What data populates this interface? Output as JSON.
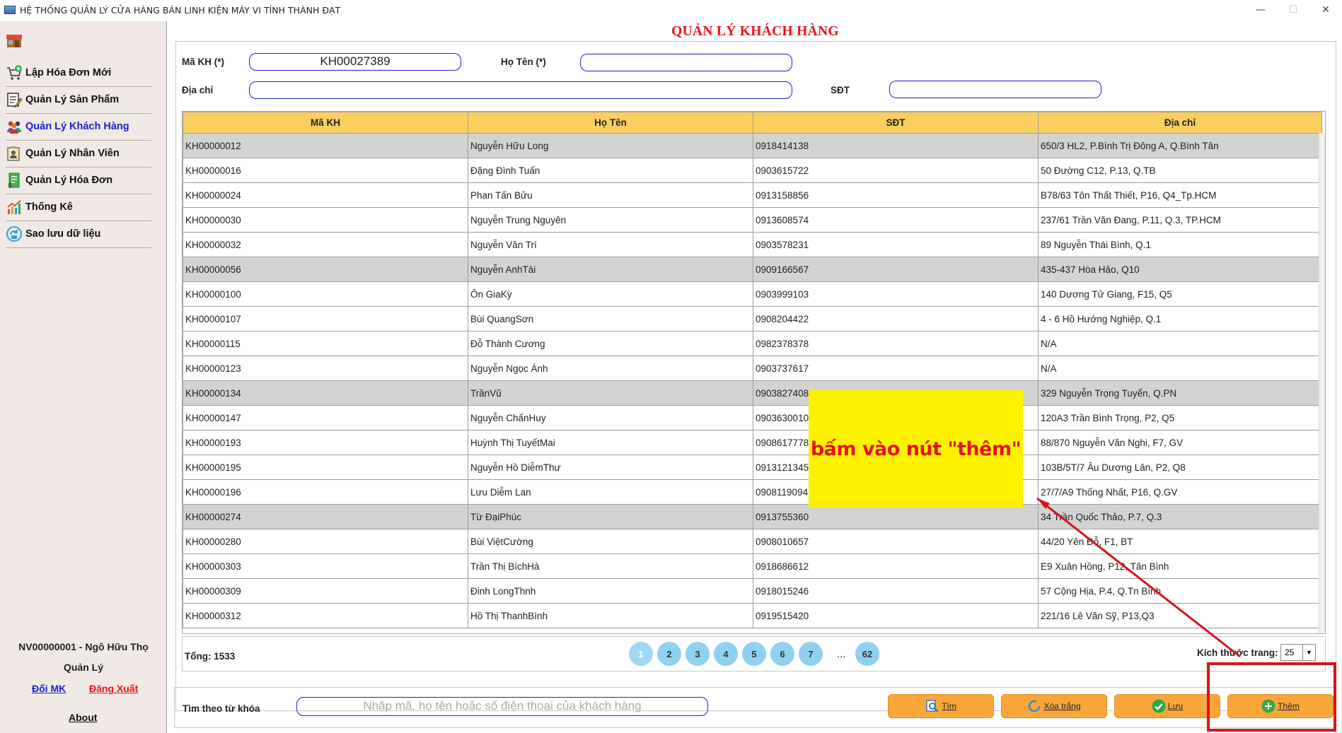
{
  "window": {
    "title": "HỆ THỐNG QUẢN LÝ CỬA HÀNG BÁN LINH KIỆN MÁY VI TÍNH THÀNH ĐẠT",
    "minimize": "—",
    "maximize": "☐",
    "close": "✕"
  },
  "sidebar": {
    "items": [
      {
        "label": "Lập Hóa Đơn Mới",
        "icon": "cart-add-icon"
      },
      {
        "label": "Quản Lý Sản Phẩm",
        "icon": "edit-list-icon"
      },
      {
        "label": "Quản Lý Khách Hàng",
        "icon": "customers-icon"
      },
      {
        "label": "Quản Lý Nhân Viên",
        "icon": "employee-icon"
      },
      {
        "label": "Quản Lý Hóa Đơn",
        "icon": "invoice-icon"
      },
      {
        "label": "Thống Kê",
        "icon": "chart-icon"
      },
      {
        "label": "Sao lưu dữ liệu",
        "icon": "backup-icon"
      }
    ],
    "active_index": 2,
    "user_line": "NV00000001 - Ngô Hữu  Thọ",
    "role": "Quản Lý",
    "change_password": "Đổi MK",
    "logout": "Đăng Xuất",
    "about": "About"
  },
  "page": {
    "title": "QUẢN LÝ KHÁCH HÀNG"
  },
  "form": {
    "id_label": "Mã KH (*)",
    "id_value": "KH00027389",
    "name_label": "Họ Tên (*)",
    "name_value": "",
    "address_label": "Địa chỉ",
    "address_value": "",
    "phone_label": "SĐT",
    "phone_value": ""
  },
  "table": {
    "columns": [
      "Mã KH",
      "Họ Tên",
      "SĐT",
      "Địa chỉ"
    ],
    "rows": [
      {
        "id": "KH00000012",
        "name": "Nguyễn Hữu Long",
        "phone": "0918414138",
        "address": "650/3 HL2, P.Bình Trị Đông A, Q.Bình Tân",
        "shaded": true
      },
      {
        "id": "KH00000016",
        "name": "Đặng Đình Tuấn",
        "phone": "0903615722",
        "address": "50 Đường C12, P.13, Q.TB",
        "shaded": false
      },
      {
        "id": "KH00000024",
        "name": "Phan Tấn Bửu",
        "phone": "0913158856",
        "address": "B78/63 Tôn Thất Thiết, P16, Q4_Tp.HCM",
        "shaded": false
      },
      {
        "id": "KH00000030",
        "name": "Nguyễn Trung Nguyên",
        "phone": "0913608574",
        "address": "237/61 Trần Văn Đang, P.11, Q.3, TP.HCM",
        "shaded": false
      },
      {
        "id": "KH00000032",
        "name": "Nguyễn Văn Trí",
        "phone": "0903578231",
        "address": "89 Nguyễn Thái Bình, Q.1",
        "shaded": false
      },
      {
        "id": "KH00000056",
        "name": "Nguyễn AnhTài",
        "phone": "0909166567",
        "address": "435-437 Hòa Hảo, Q10",
        "shaded": true
      },
      {
        "id": "KH00000100",
        "name": "Ôn GiaKỳ",
        "phone": "0903999103",
        "address": "140 Dương Tử Giang, F15, Q5",
        "shaded": false
      },
      {
        "id": "KH00000107",
        "name": "Bùi QuangSơn",
        "phone": "0908204422",
        "address": "4 - 6 Hồ Hướng Nghiệp, Q.1",
        "shaded": false
      },
      {
        "id": "KH00000115",
        "name": "Đỗ Thành Cương",
        "phone": "0982378378",
        "address": "N/A",
        "shaded": false
      },
      {
        "id": "KH00000123",
        "name": "Nguyễn Ngọc Ánh",
        "phone": "0903737617",
        "address": "N/A",
        "shaded": false
      },
      {
        "id": "KH00000134",
        "name": "TrầnVũ",
        "phone": "0903827408",
        "address": "329 Nguyễn Trọng Tuyển, Q.PN",
        "shaded": true
      },
      {
        "id": "KH00000147",
        "name": "Nguyễn ChấnHuy",
        "phone": "0903630010",
        "address": "120A3 Trần Bình Trọng, P2, Q5",
        "shaded": false
      },
      {
        "id": "KH00000193",
        "name": "Huỳnh Thị TuyếtMai",
        "phone": "0908617778",
        "address": "88/870 Nguyễn Văn Nghi, F7, GV",
        "shaded": false
      },
      {
        "id": "KH00000195",
        "name": "Nguyễn Hồ DiễmThư",
        "phone": "0913121345",
        "address": "103B/5T/7 Âu Dương Lân, P2, Q8",
        "shaded": false
      },
      {
        "id": "KH00000196",
        "name": "Lưu Diễm Lan",
        "phone": "0908119094",
        "address": "27/7/A9 Thống Nhất, P16, Q.GV",
        "shaded": false
      },
      {
        "id": "KH00000274",
        "name": "Từ ĐạiPhúc",
        "phone": "0913755360",
        "address": "34 Trần Quốc Thảo, P.7, Q.3",
        "shaded": true
      },
      {
        "id": "KH00000280",
        "name": "Bùi ViệtCường",
        "phone": "0908010657",
        "address": "44/20 Yên Đỗ, F1, BT",
        "shaded": false
      },
      {
        "id": "KH00000303",
        "name": "Trần Thị BíchHà",
        "phone": "0918686612",
        "address": "E9 Xuân Hồng, P12, Tân Bình",
        "shaded": false
      },
      {
        "id": "KH00000309",
        "name": "Đinh LongThnh",
        "phone": "0918015246",
        "address": "57 Cộng Hịa, P.4, Q.Tn Bình",
        "shaded": false
      },
      {
        "id": "KH00000312",
        "name": "Hồ Thị ThanhBình",
        "phone": "0919515420",
        "address": "221/16 Lê Văn Sỹ, P13,Q3",
        "shaded": false
      }
    ]
  },
  "pagination": {
    "total": "Tổng: 1533",
    "pages": [
      "1",
      "2",
      "3",
      "4",
      "5",
      "6",
      "7"
    ],
    "ellipsis": "...",
    "last": "62",
    "current": "1",
    "page_size_label": "Kích thước trang:",
    "page_size": "25"
  },
  "search": {
    "label": "Tìm theo từ khóa",
    "placeholder": "Nhập mã, họ tên hoặc số điện thoại của khách hàng"
  },
  "buttons": {
    "find": "Tìm",
    "clear": "Xóa trắng",
    "save": "Lưu",
    "add": "Thêm"
  },
  "annotation": {
    "text": "bấm vào nút \"thêm\""
  },
  "colors": {
    "title_red": "#e8141b",
    "active_nav": "#1b20d6",
    "header_bg": "#fbcf5f",
    "button_orange": "#fba63b",
    "page_circle": "#8fd0f3",
    "callout_bg": "#fff200",
    "annotation_red": "#d7141a"
  }
}
